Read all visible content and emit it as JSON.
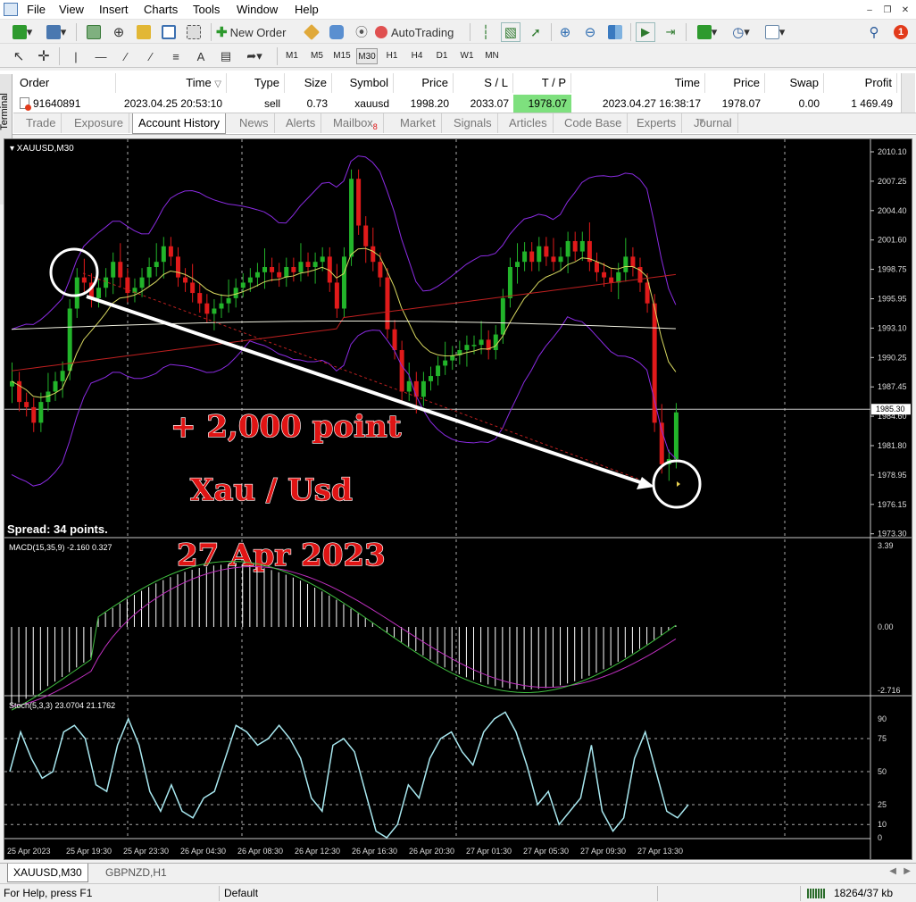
{
  "menu": [
    "File",
    "View",
    "Insert",
    "Charts",
    "Tools",
    "Window",
    "Help"
  ],
  "toolbar": {
    "new_order": "New Order",
    "autotrading": "AutoTrading"
  },
  "timeframes": [
    "M1",
    "M5",
    "M15",
    "M30",
    "H1",
    "H4",
    "D1",
    "W1",
    "MN"
  ],
  "active_timeframe": "M30",
  "notification_count": "1",
  "terminal": {
    "side_label": "Terminal",
    "columns": [
      "Order",
      "Time",
      "Type",
      "Size",
      "Symbol",
      "Price",
      "S / L",
      "T / P",
      "Time",
      "Price",
      "Swap",
      "Profit"
    ],
    "row": {
      "order": "91640891",
      "open_time": "2023.04.25 20:53:10",
      "type": "sell",
      "size": "0.73",
      "symbol": "xauusd",
      "open_price": "1998.20",
      "sl": "2033.07",
      "tp": "1978.07",
      "close_time": "2023.04.27 16:38:17",
      "close_price": "1978.07",
      "swap": "0.00",
      "profit": "1 469.49"
    },
    "tabs": [
      "Trade",
      "Exposure",
      "Account History",
      "News",
      "Alerts",
      "Mailbox",
      "Market",
      "Signals",
      "Articles",
      "Code Base",
      "Experts",
      "Journal"
    ],
    "mailbox_badge": "8",
    "active_tab": "Account History"
  },
  "chart": {
    "symbol_label": "XAUUSD,M30",
    "spread_label": "Spread: 34 points.",
    "price_axis": [
      "2010.10",
      "2007.25",
      "2004.40",
      "2001.60",
      "1998.75",
      "1995.95",
      "1993.10",
      "1990.25",
      "1987.45",
      "1984.60",
      "1981.80",
      "1978.95",
      "1976.15",
      "1973.30"
    ],
    "current_price": "1985.30",
    "macd_label": "MACD(15,35,9) -2.160 0.327",
    "macd_axis": [
      "3.39",
      "0.00",
      "-2.716"
    ],
    "stoch_label": "Stoch(5,3,3) 23.0704 21.1762",
    "stoch_axis": [
      "90",
      "75",
      "50",
      "25",
      "10",
      "0"
    ],
    "time_axis": [
      "25 Apr 2023",
      "25 Apr 19:30",
      "25 Apr 23:30",
      "26 Apr 04:30",
      "26 Apr 08:30",
      "26 Apr 12:30",
      "26 Apr 16:30",
      "26 Apr 20:30",
      "27 Apr 01:30",
      "27 Apr 05:30",
      "27 Apr 09:30",
      "27 Apr 13:30"
    ],
    "annotations": {
      "profit": "+ 2,000 point",
      "pair": "Xau / Usd",
      "date": "27 Apr 2023"
    },
    "colors": {
      "bull": "#22b42a",
      "bear": "#e01a1a",
      "bands": "#8a2be2",
      "ma_fast": "#d8d860",
      "ma_slow": "#c02020",
      "ma_long": "#f0f0e0",
      "macd_signal": "#c030c0",
      "macd_line": "#40c040",
      "stoch": "#a8e8f0"
    }
  },
  "chart_tabs": [
    "XAUUSD,M30",
    "GBPNZD,H1"
  ],
  "status": {
    "help": "For Help, press F1",
    "profile": "Default",
    "net": "18264/37 kb"
  }
}
